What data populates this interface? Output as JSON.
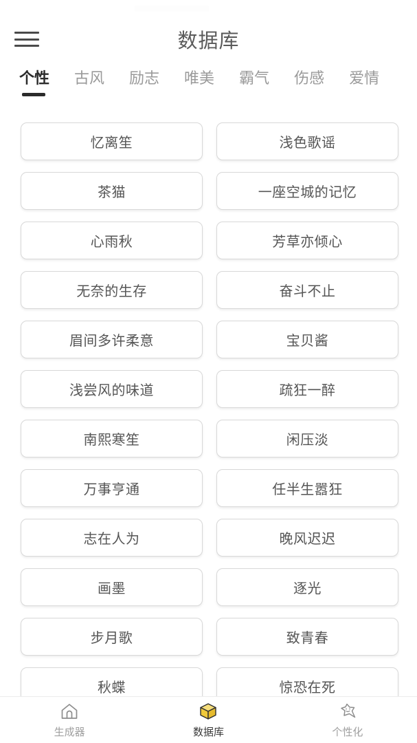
{
  "header": {
    "title": "数据库",
    "menu_icon": "hamburger-menu-icon"
  },
  "tabs": [
    {
      "label": "个性",
      "active": true
    },
    {
      "label": "古风",
      "active": false
    },
    {
      "label": "励志",
      "active": false
    },
    {
      "label": "唯美",
      "active": false
    },
    {
      "label": "霸气",
      "active": false
    },
    {
      "label": "伤感",
      "active": false
    },
    {
      "label": "爱情",
      "active": false
    }
  ],
  "cards": [
    "忆离笙",
    "浅色歌谣",
    "茶猫",
    "一座空城的记忆",
    "心雨秋",
    "芳草亦倾心",
    "无奈的生存",
    "奋斗不止",
    "眉间多许柔意",
    "宝贝酱",
    "浅尝风的味道",
    "疏狂一醉",
    "南熙寒笙",
    "闲压淡",
    "万事亨通",
    "任半生嚣狂",
    "志在人为",
    "晚风迟迟",
    "画墨",
    "逐光",
    "步月歌",
    "致青春",
    "秋蝶",
    "惊恐在死"
  ],
  "bottom_nav": [
    {
      "label": "生成器",
      "icon": "home-icon",
      "active": false
    },
    {
      "label": "数据库",
      "icon": "box-icon",
      "active": true
    },
    {
      "label": "个性化",
      "icon": "star-face-icon",
      "active": false
    }
  ],
  "colors": {
    "accent": "#f2cb3f",
    "text_primary": "#3b3b3b",
    "text_muted": "#a0a0a0",
    "card_border": "#d8d8d8"
  }
}
